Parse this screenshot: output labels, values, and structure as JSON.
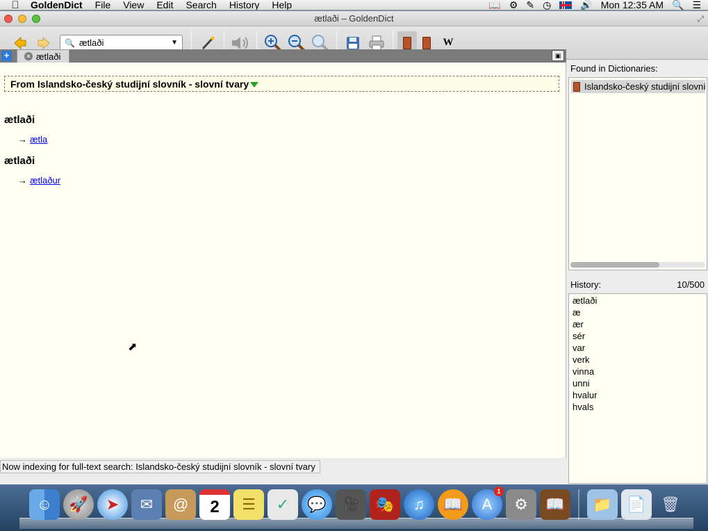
{
  "menubar": {
    "app_name": "GoldenDict",
    "items": [
      "File",
      "View",
      "Edit",
      "Search",
      "History",
      "Help"
    ],
    "clock": "Mon 12:35 AM"
  },
  "window": {
    "title": "ætlaði – GoldenDict"
  },
  "toolbar": {
    "search_value": "ætlaði",
    "wikipedia_label": "W"
  },
  "tabs": [
    {
      "label": "ætlaði"
    }
  ],
  "article": {
    "dict_header": "From Islandsko-český studijní slovník - slovní tvary",
    "entries": [
      {
        "headword": "ætlaði",
        "arrow": "→",
        "link": "ætla"
      },
      {
        "headword": "ætlaði",
        "arrow": "→",
        "link": "ætlaður"
      }
    ]
  },
  "found_in": {
    "title": "Found in Dictionaries:",
    "items": [
      "Islandsko-český studijní slovník - slovní tvary"
    ]
  },
  "history": {
    "title": "History:",
    "count": "10/500",
    "items": [
      "ætlaði",
      "æ",
      "ær",
      "sér",
      "var",
      "verk",
      "vinna",
      "unni",
      "hvalur",
      "hvals"
    ]
  },
  "status": {
    "text": "Now indexing for full-text search: Islandsko-český studijní slovník - slovní tvary"
  },
  "dock": {
    "badge_count": "1",
    "calendar_day": "2"
  },
  "colors": {
    "article_bg": "#fffef2",
    "link": "#0000ee",
    "expand_arrow": "#2a9d2a"
  }
}
